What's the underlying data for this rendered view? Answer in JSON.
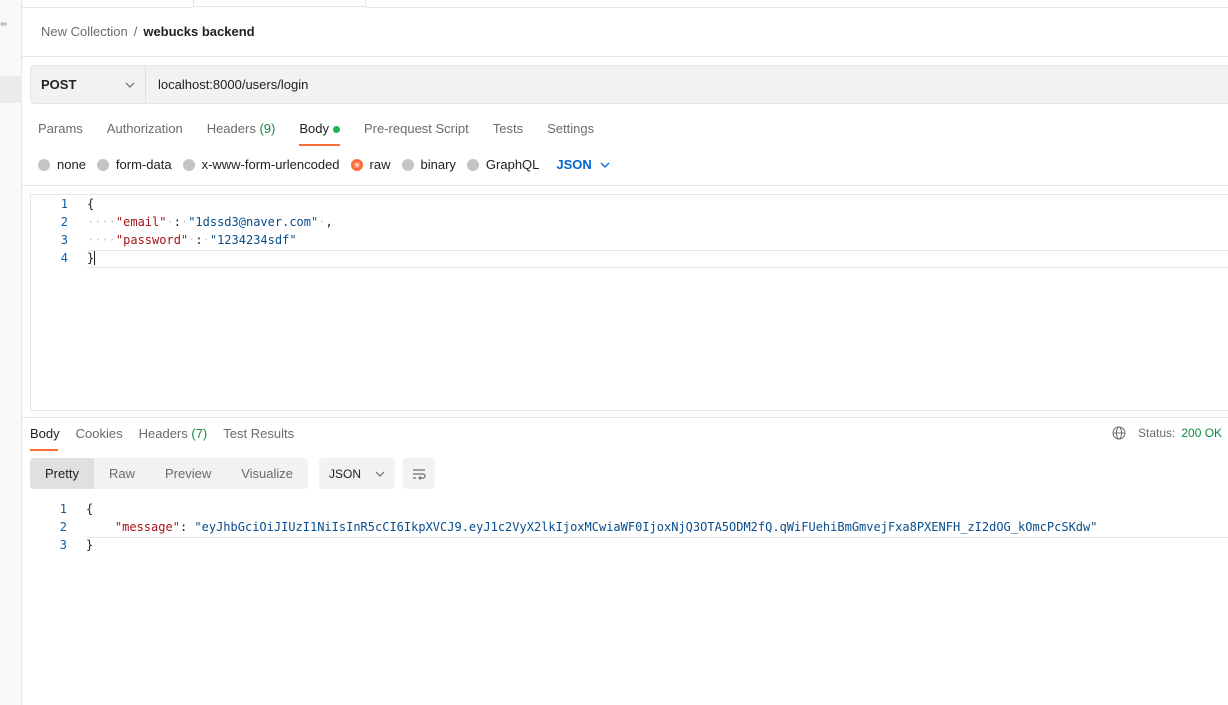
{
  "sidebar": {
    "more_icon": "more-dots-icon"
  },
  "breadcrumb": {
    "parent": "New Collection",
    "separator": "/",
    "current": "webucks backend"
  },
  "request": {
    "method": "POST",
    "url": "localhost:8000/users/login",
    "tabs": [
      {
        "label": "Params"
      },
      {
        "label": "Authorization"
      },
      {
        "label": "Headers",
        "count": "(9)"
      },
      {
        "label": "Body"
      },
      {
        "label": "Pre-request Script"
      },
      {
        "label": "Tests"
      },
      {
        "label": "Settings"
      }
    ],
    "active_tab": "Body",
    "body_types": [
      "none",
      "form-data",
      "x-www-form-urlencoded",
      "raw",
      "binary",
      "GraphQL"
    ],
    "selected_body_type": "raw",
    "format": "JSON",
    "body_lines": [
      {
        "num": "1",
        "text": "{"
      },
      {
        "num": "2",
        "key": "\"email\"",
        "value": "\"1dssd3@naver.com\""
      },
      {
        "num": "3",
        "key": "\"password\"",
        "value": "\"1234234sdf\""
      },
      {
        "num": "4",
        "text": "}"
      }
    ]
  },
  "response": {
    "tabs": [
      {
        "label": "Body"
      },
      {
        "label": "Cookies"
      },
      {
        "label": "Headers",
        "count": "(7)"
      },
      {
        "label": "Test Results"
      }
    ],
    "status_label": "Status:",
    "status_value": "200 OK",
    "views": [
      "Pretty",
      "Raw",
      "Preview",
      "Visualize"
    ],
    "active_view": "Pretty",
    "format": "JSON",
    "body_lines": [
      {
        "num": "1",
        "text": "{"
      },
      {
        "num": "2",
        "key": "\"message\"",
        "value": "\"eyJhbGciOiJIUzI1NiIsInR5cCI6IkpXVCJ9.eyJ1c2VyX2lkIjoxMCwiaWF0IjoxNjQ3OTA5ODM2fQ.qWiFUehiBmGmvejFxa8PXENFH_zI2dOG_kOmcPcSKdw\""
      },
      {
        "num": "3",
        "text": "}"
      }
    ]
  },
  "colors": {
    "accent": "#ff6c37",
    "success": "#0e8a3f",
    "link": "#0265d2"
  }
}
